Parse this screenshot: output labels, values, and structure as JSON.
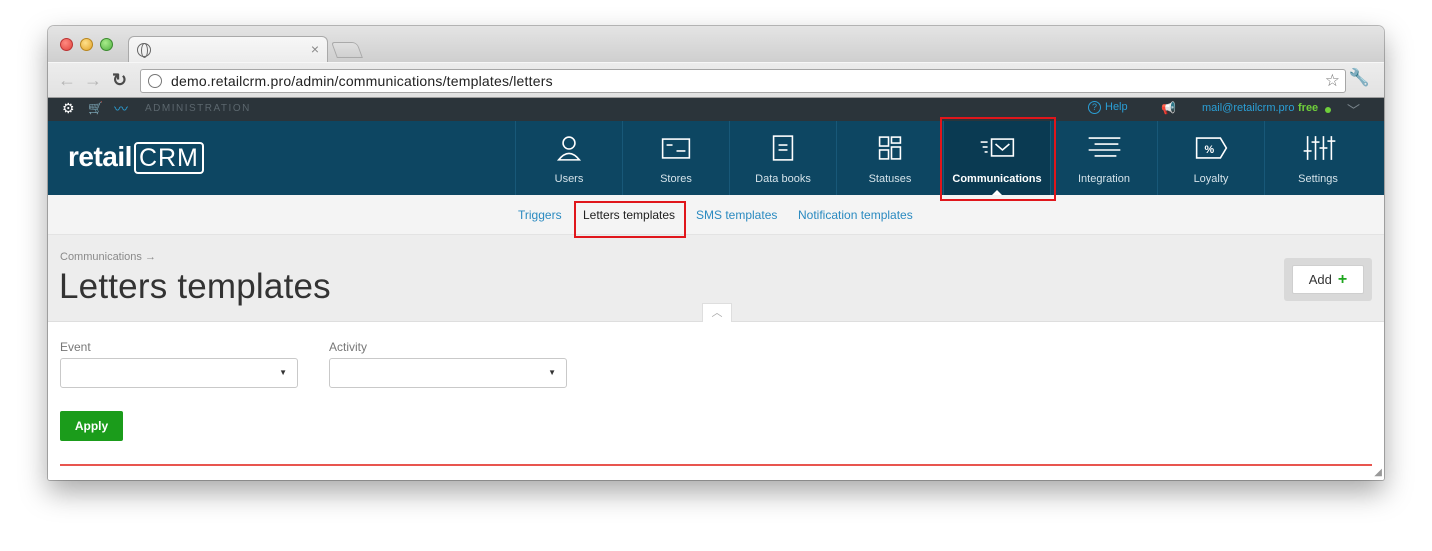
{
  "browser": {
    "tab_close": "×",
    "url": "demo.retailcrm.pro/admin/communications/templates/letters"
  },
  "adminbar": {
    "section_label": "ADMINISTRATION",
    "help_label": "Help",
    "user_email": "mail@retailcrm.pro",
    "plan": "free"
  },
  "logo": {
    "text": "retail",
    "mark": "CRM"
  },
  "mainnav": [
    {
      "label": "Users",
      "icon": "user-icon"
    },
    {
      "label": "Stores",
      "icon": "store-icon"
    },
    {
      "label": "Data books",
      "icon": "book-icon"
    },
    {
      "label": "Statuses",
      "icon": "statuses-icon"
    },
    {
      "label": "Communications",
      "icon": "mail-icon",
      "active": true
    },
    {
      "label": "Integration",
      "icon": "integration-icon"
    },
    {
      "label": "Loyalty",
      "icon": "percent-tag-icon"
    },
    {
      "label": "Settings",
      "icon": "sliders-icon"
    }
  ],
  "subnav": [
    {
      "label": "Triggers"
    },
    {
      "label": "Letters templates",
      "active": true
    },
    {
      "label": "SMS templates"
    },
    {
      "label": "Notification templates"
    }
  ],
  "page": {
    "breadcrumb": "Communications →",
    "title": "Letters templates",
    "add_label": "Add",
    "add_plus": "+"
  },
  "filters": {
    "event_label": "Event",
    "event_value": "",
    "activity_label": "Activity",
    "activity_value": "",
    "apply_label": "Apply"
  },
  "colors": {
    "nav_bg": "#0d4662",
    "admin_bar_bg": "#2b343a",
    "accent_link": "#2a8ac0",
    "apply_green": "#1b9c1b",
    "highlight_red": "#e0161b"
  }
}
